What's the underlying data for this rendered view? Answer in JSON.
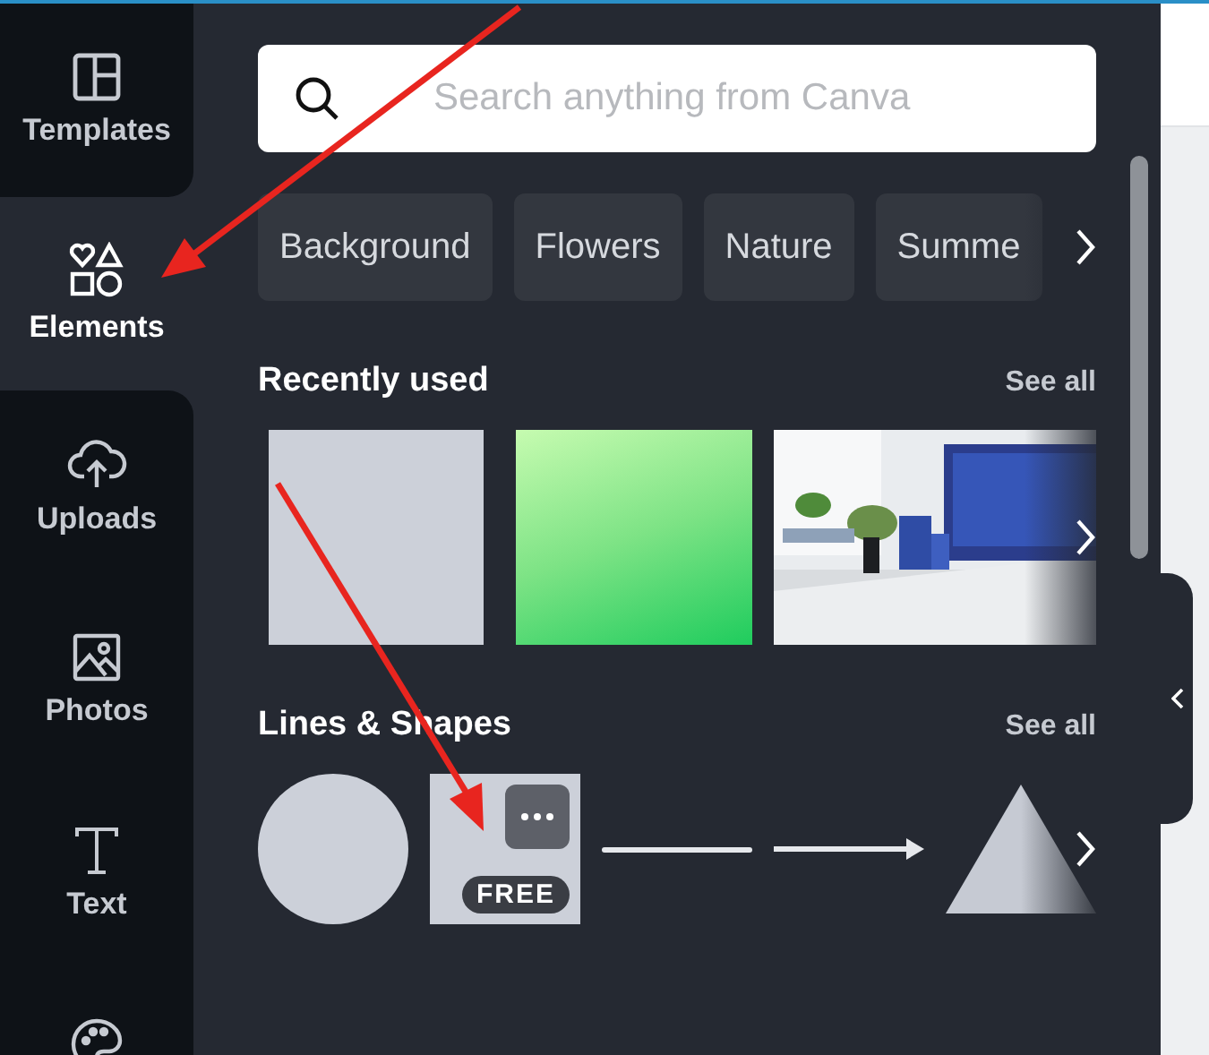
{
  "sidebar": {
    "items": [
      {
        "label": "Templates",
        "selected": false
      },
      {
        "label": "Elements",
        "selected": true
      },
      {
        "label": "Uploads",
        "selected": false
      },
      {
        "label": "Photos",
        "selected": false
      },
      {
        "label": "Text",
        "selected": false
      }
    ]
  },
  "search": {
    "placeholder": "Search anything from Canva"
  },
  "chips": [
    "Background",
    "Flowers",
    "Nature",
    "Summe"
  ],
  "sections": [
    {
      "title": "Recently used",
      "see_all": "See all",
      "items": [
        {
          "kind": "blank"
        },
        {
          "kind": "gradient"
        },
        {
          "kind": "picture"
        }
      ]
    },
    {
      "title": "Lines & Shapes",
      "see_all": "See all",
      "items": [
        {
          "kind": "circle"
        },
        {
          "kind": "square",
          "badge": "FREE"
        },
        {
          "kind": "line"
        },
        {
          "kind": "arrow"
        },
        {
          "kind": "triangle"
        }
      ]
    }
  ]
}
